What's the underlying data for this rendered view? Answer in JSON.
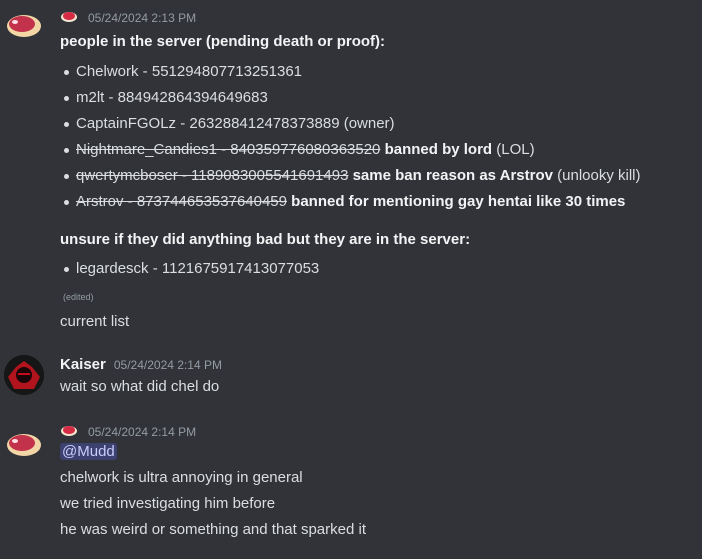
{
  "messages": {
    "m1": {
      "timestamp": "05/24/2024 2:13 PM",
      "header": "people in the server (pending death or proof):",
      "items": [
        {
          "text": "Chelwork - 551294807713251361"
        },
        {
          "text": "m2lt - 884942864394649683"
        },
        {
          "text": "CaptainFGOLz - 263288412478373889 (owner)"
        },
        {
          "strike": "Nightmare_Candies1 - 840359776080363520",
          "bold": " banned by lord",
          "rest": " (LOL)"
        },
        {
          "strike": "qwertymcboser - 1189083005541691493",
          "bold": " same ban reason as Arstrov",
          "rest": " (unlooky kill)"
        },
        {
          "strike": "Arstrov - 873744653537640459",
          "bold": " banned for mentioning gay hentai like 30 times",
          "rest": ""
        }
      ],
      "header2": "unsure if they did anything bad but they are in the server:",
      "items2": [
        {
          "text": "legardesck - 1121675917413077053"
        }
      ],
      "edited": "(edited)",
      "text": "current list"
    },
    "m2": {
      "author": "Kaiser",
      "timestamp": "05/24/2024 2:14 PM",
      "text": "wait so what did chel do"
    },
    "m3": {
      "timestamp": "05/24/2024 2:14 PM",
      "mention": "@Mudd",
      "lines": [
        "chelwork is ultra annoying in general",
        "we tried investigating him before",
        "he was weird or something and that sparked it"
      ]
    }
  },
  "colors": {
    "background": "#313338",
    "text": "#dbdee1",
    "muted": "#949ba4",
    "mention_bg": "#3c4270"
  },
  "icons": {
    "m1_avatar": "meat-icon",
    "m1_badge": "meat-icon",
    "m2_avatar": "dark-avatar",
    "m3_avatar": "meat-icon",
    "m3_badge": "meat-icon"
  }
}
